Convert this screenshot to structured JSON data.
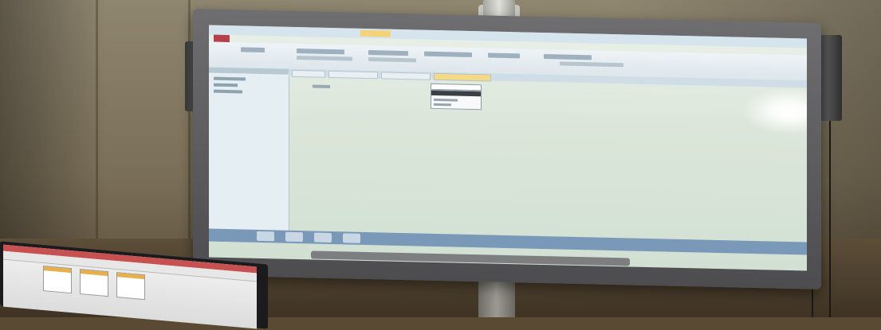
{
  "scene": {
    "description_kind": "photo",
    "colors": {
      "screen": "#dbe6d9",
      "frame": "#5e5e60",
      "wall": "#7a6f58",
      "laptop_bezel": "#1b1b1e"
    }
  },
  "icons": [
    "speaker-left",
    "speaker-right",
    "glare-highlight"
  ]
}
